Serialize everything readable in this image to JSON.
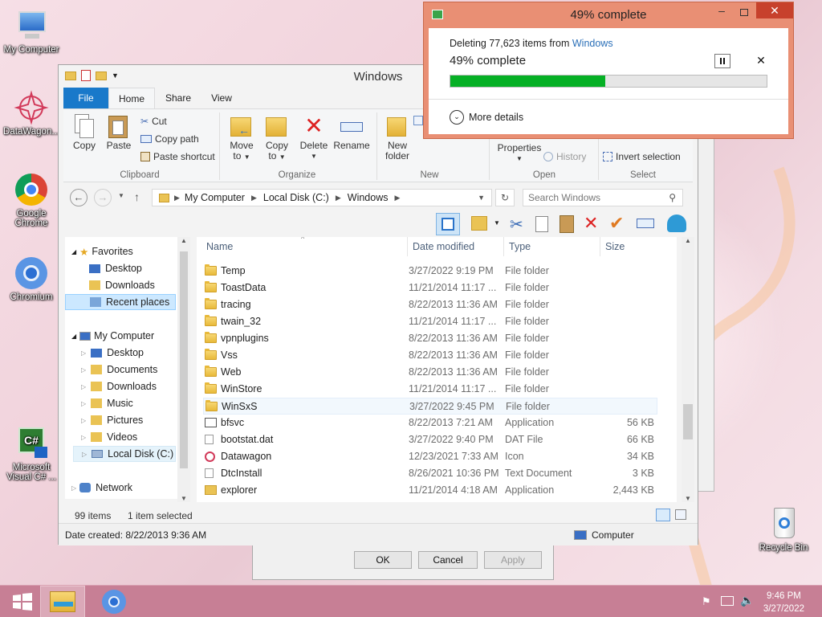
{
  "desktop": {
    "icons": [
      {
        "label": "My Computer",
        "icon": "computer-icon"
      },
      {
        "label": "DataWagon...",
        "icon": "datawagon-icon"
      },
      {
        "label": "Google Chrome",
        "icon": "chrome-icon"
      },
      {
        "label": "Chromium",
        "icon": "chromium-icon"
      },
      {
        "label": "Microsoft Visual C# ...",
        "icon": "visual-csharp-icon"
      },
      {
        "label": "Recycle Bin",
        "icon": "recycle-bin-icon"
      }
    ]
  },
  "taskbar": {
    "time": "9:46 PM",
    "date": "3/27/2022",
    "items": [
      "start-button",
      "file-explorer-icon",
      "chromium-icon"
    ]
  },
  "explorer": {
    "title": "Windows",
    "tabs": {
      "file": "File",
      "home": "Home",
      "share": "Share",
      "view": "View"
    },
    "ribbon": {
      "copy": "Copy",
      "paste": "Paste",
      "cut": "Cut",
      "copy_path": "Copy path",
      "paste_shortcut": "Paste shortcut",
      "clipboard": "Clipboard",
      "move_to": "Move",
      "move_to2": "to",
      "copy_to": "Copy",
      "copy_to2": "to",
      "delete": "Delete",
      "rename": "Rename",
      "organize": "Organize",
      "new_folder": "New",
      "new_folder2": "folder",
      "new": "New",
      "properties": "Properties",
      "history": "History",
      "open": "Open",
      "invert_selection": "Invert selection",
      "select": "Select"
    },
    "address": {
      "crumbs": [
        "My Computer",
        "Local Disk (C:)",
        "Windows"
      ],
      "search_placeholder": "Search Windows"
    },
    "nav": {
      "favorites": "Favorites",
      "fav_items": [
        "Desktop",
        "Downloads",
        "Recent places"
      ],
      "my_computer": "My Computer",
      "pc_items": [
        "Desktop",
        "Documents",
        "Downloads",
        "Music",
        "Pictures",
        "Videos",
        "Local Disk (C:)"
      ],
      "network": "Network"
    },
    "columns": {
      "name": "Name",
      "date": "Date modified",
      "type": "Type",
      "size": "Size"
    },
    "files": [
      {
        "name": "Temp",
        "date": "3/27/2022 9:19 PM",
        "type": "File folder",
        "size": "",
        "kind": "folder"
      },
      {
        "name": "ToastData",
        "date": "11/21/2014 11:17 ...",
        "type": "File folder",
        "size": "",
        "kind": "folder"
      },
      {
        "name": "tracing",
        "date": "8/22/2013 11:36 AM",
        "type": "File folder",
        "size": "",
        "kind": "folder"
      },
      {
        "name": "twain_32",
        "date": "11/21/2014 11:17 ...",
        "type": "File folder",
        "size": "",
        "kind": "folder"
      },
      {
        "name": "vpnplugins",
        "date": "8/22/2013 11:36 AM",
        "type": "File folder",
        "size": "",
        "kind": "folder"
      },
      {
        "name": "Vss",
        "date": "8/22/2013 11:36 AM",
        "type": "File folder",
        "size": "",
        "kind": "folder"
      },
      {
        "name": "Web",
        "date": "8/22/2013 11:36 AM",
        "type": "File folder",
        "size": "",
        "kind": "folder"
      },
      {
        "name": "WinStore",
        "date": "11/21/2014 11:17 ...",
        "type": "File folder",
        "size": "",
        "kind": "folder"
      },
      {
        "name": "WinSxS",
        "date": "3/27/2022 9:45 PM",
        "type": "File folder",
        "size": "",
        "kind": "folder"
      },
      {
        "name": "bfsvc",
        "date": "8/22/2013 7:21 AM",
        "type": "Application",
        "size": "56 KB",
        "kind": "app"
      },
      {
        "name": "bootstat.dat",
        "date": "3/27/2022 9:40 PM",
        "type": "DAT File",
        "size": "66 KB",
        "kind": "file"
      },
      {
        "name": "Datawagon",
        "date": "12/23/2021 7:33 AM",
        "type": "Icon",
        "size": "34 KB",
        "kind": "icon"
      },
      {
        "name": "DtcInstall",
        "date": "8/26/2021 10:36 PM",
        "type": "Text Document",
        "size": "3 KB",
        "kind": "file"
      },
      {
        "name": "explorer",
        "date": "11/21/2014 4:18 AM",
        "type": "Application",
        "size": "2,443 KB",
        "kind": "explorer"
      }
    ],
    "status": {
      "count": "99 items",
      "selected": "1 item selected"
    },
    "details": {
      "date_created": "Date created: 8/22/2013 9:36 AM",
      "location": "Computer"
    }
  },
  "properties_dialog": {
    "ok": "OK",
    "cancel": "Cancel",
    "apply": "Apply"
  },
  "progress": {
    "title": "49% complete",
    "deleting_prefix": "Deleting 77,623 items from",
    "deleting_target": "Windows",
    "percent_label": "49% complete",
    "progress_fraction": 0.49,
    "more_details": "More details",
    "accent": "#06b025"
  }
}
